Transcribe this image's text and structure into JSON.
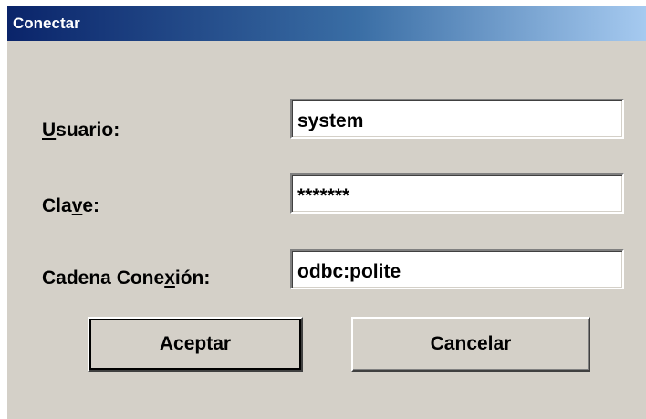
{
  "window": {
    "title": "Conectar"
  },
  "form": {
    "user": {
      "label_pre": "",
      "label_key": "U",
      "label_post": "suario:",
      "value": "system"
    },
    "password": {
      "label_pre": "Cla",
      "label_key": "v",
      "label_post": "e:",
      "value": "*******"
    },
    "connection": {
      "label_pre": "Cadena Cone",
      "label_key": "x",
      "label_post": "ión:",
      "value": "odbc:polite"
    }
  },
  "buttons": {
    "accept": "Aceptar",
    "cancel": "Cancelar"
  }
}
